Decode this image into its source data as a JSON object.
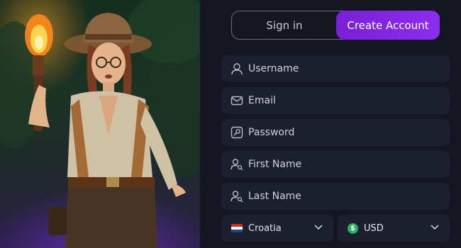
{
  "tabs": {
    "signin_label": "Sign in",
    "create_label": "Create Account"
  },
  "form": {
    "username": {
      "placeholder": "Username",
      "icon": "user-icon"
    },
    "email": {
      "placeholder": "Email",
      "icon": "envelope-icon"
    },
    "password": {
      "placeholder": "Password",
      "icon": "key-icon"
    },
    "first_name": {
      "placeholder": "First Name",
      "icon": "user-search-icon"
    },
    "last_name": {
      "placeholder": "Last Name",
      "icon": "user-search-icon"
    },
    "country": {
      "value": "Croatia",
      "icon": "croatia-flag-icon"
    },
    "currency": {
      "value": "USD",
      "icon": "dollar-coin-icon"
    }
  },
  "colors": {
    "accent": "#7a1fd6",
    "panel_bg": "#141622",
    "field_bg": "#1c1f2d"
  }
}
